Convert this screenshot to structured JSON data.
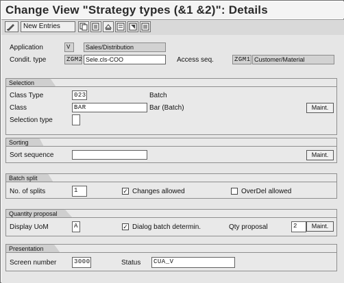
{
  "window": {
    "title": "Change View \"Strategy types (&1 &2)\": Details"
  },
  "toolbar": {
    "new_entries_label": "New Entries",
    "icons": [
      "edit-icon",
      "copy-icon",
      "delete-icon",
      "undo-icon",
      "first-page-icon",
      "previous-page-icon",
      "next-page-icon"
    ]
  },
  "header": {
    "application_label": "Application",
    "application_value": "V",
    "application_text": "Sales/Distribution",
    "condit_type_label": "Condit. type",
    "condit_type_value": "ZGM2",
    "condit_type_text": "Sele.cls-COO",
    "access_seq_label": "Access seq.",
    "access_seq_value": "ZGM1",
    "access_seq_text": "Customer/Material"
  },
  "selection": {
    "title": "Selection",
    "class_type_label": "Class Type",
    "class_type_value": "023",
    "class_type_text": "Batch",
    "class_label": "Class",
    "class_value": "BAR",
    "class_text": "Bar (Batch)",
    "selection_type_label": "Selection type",
    "selection_type_value": "",
    "maint_label": "Maint."
  },
  "sorting": {
    "title": "Sorting",
    "sort_sequence_label": "Sort sequence",
    "sort_sequence_value": "",
    "maint_label": "Maint."
  },
  "batch_split": {
    "title": "Batch split",
    "no_splits_label": "No. of splits",
    "no_splits_value": "1",
    "changes_allowed_label": "Changes allowed",
    "changes_allowed_checked": true,
    "overdel_allowed_label": "OverDel allowed",
    "overdel_allowed_checked": false
  },
  "quantity_proposal": {
    "title": "Quantity proposal",
    "display_uom_label": "Display UoM",
    "display_uom_value": "A",
    "dialog_batch_label": "Dialog batch determin.",
    "dialog_batch_checked": true,
    "qty_proposal_label": "Qty proposal",
    "qty_proposal_value": "2",
    "maint_label": "Maint."
  },
  "presentation": {
    "title": "Presentation",
    "screen_number_label": "Screen number",
    "screen_number_value": "3000",
    "status_label": "Status",
    "status_value": "CUA_V"
  }
}
